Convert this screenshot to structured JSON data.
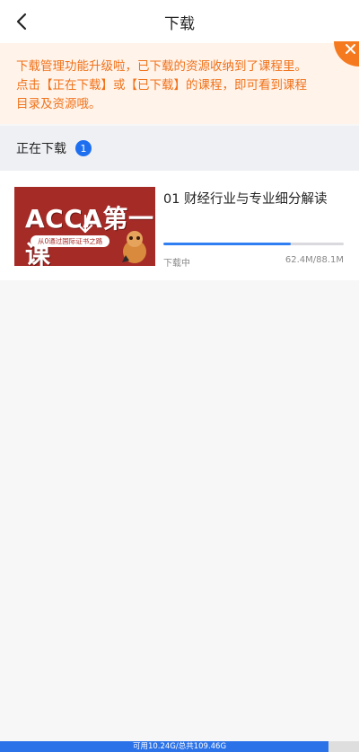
{
  "header": {
    "title": "下载",
    "back_icon": "back-chevron-icon"
  },
  "notice": {
    "line1": "下载管理功能升级啦，已下载的资源收纳到了课程里。",
    "line2": "点击【正在下载】或【已下载】的课程，即可看到课程",
    "line3": "目录及资源哦。",
    "close_icon": "close-icon",
    "color": "#f0721a",
    "background": "#fff3ea"
  },
  "downloading": {
    "label": "正在下载",
    "count": "1",
    "items": [
      {
        "title": "01 财经行业与专业细分解读",
        "thumb_title": "ACCA第一课",
        "thumb_subtitle": "从0通过国际证书之路",
        "status": "下载中",
        "size_text": "62.4M/88.1M",
        "progress": 0.708
      }
    ]
  },
  "storage": {
    "text": "可用10.24G/总共109.46G",
    "used_fraction": 0.915
  },
  "colors": {
    "accent": "#2f7ef2",
    "badge": "#1e6ff0",
    "thumbnail_red": "#a52b27"
  }
}
